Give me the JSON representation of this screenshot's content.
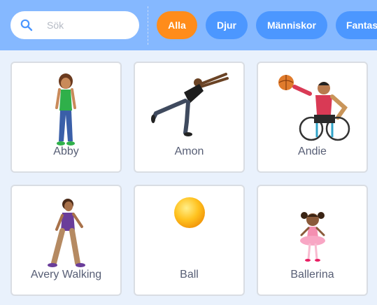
{
  "search": {
    "placeholder": "Sök",
    "value": ""
  },
  "tabs": [
    {
      "label": "Alla",
      "active": true
    },
    {
      "label": "Djur",
      "active": false
    },
    {
      "label": "Människor",
      "active": false
    },
    {
      "label": "Fantasy",
      "active": false
    }
  ],
  "sprites": [
    {
      "name": "Abby",
      "icon": "abby-sprite"
    },
    {
      "name": "Amon",
      "icon": "amon-sprite"
    },
    {
      "name": "Andie",
      "icon": "andie-sprite"
    },
    {
      "name": "Avery Walking",
      "icon": "avery-walking-sprite"
    },
    {
      "name": "Ball",
      "icon": "ball-sprite"
    },
    {
      "name": "Ballerina",
      "icon": "ballerina-sprite"
    }
  ],
  "colors": {
    "topbar": "#85b8ff",
    "tab_active": "#ff8c1a",
    "tab_normal": "#4c97ff",
    "background": "#e9f1fc"
  }
}
